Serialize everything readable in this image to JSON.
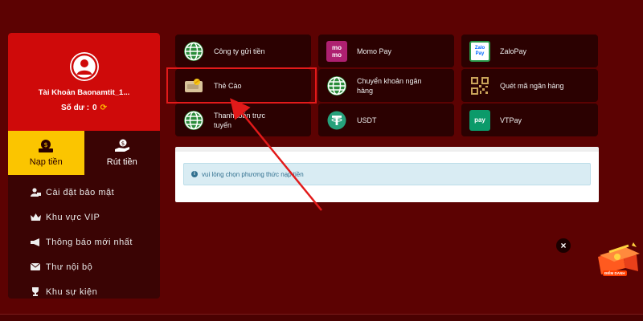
{
  "account": {
    "name": "Tài Khoản Baonamtit_1...",
    "balance_label": "Số dư :",
    "balance_value": "0"
  },
  "tabs": [
    {
      "label": "Nạp tiền",
      "active": true
    },
    {
      "label": "Rút tiền",
      "active": false
    }
  ],
  "menu": [
    {
      "label": "Cài đặt bảo mật",
      "icon": "user-lock-icon"
    },
    {
      "label": "Khu vực VIP",
      "icon": "crown-icon"
    },
    {
      "label": "Thông báo mới nhất",
      "icon": "megaphone-icon"
    },
    {
      "label": "Thư nội bộ",
      "icon": "envelope-icon"
    },
    {
      "label": "Khu sự kiện",
      "icon": "trophy-icon"
    }
  ],
  "payments": [
    {
      "label": "Công ty gửi tiền",
      "icon": "globe-icon"
    },
    {
      "label": "Momo Pay",
      "icon": "momo-icon",
      "icon_text": "mo mo"
    },
    {
      "label": "ZaloPay",
      "icon": "zalopay-icon",
      "icon_text": "Zalo Pay"
    },
    {
      "label": "Thẻ Cào",
      "icon": "card-icon"
    },
    {
      "label": "Chuyển khoản ngân hàng",
      "icon": "globe-icon"
    },
    {
      "label": "Quét mã ngân hàng",
      "icon": "qr-icon"
    },
    {
      "label": "Thanh toán trực tuyến",
      "icon": "globe-icon"
    },
    {
      "label": "USDT",
      "icon": "tether-icon"
    },
    {
      "label": "VTPay",
      "icon": "vtpay-icon",
      "icon_text": "pay"
    }
  ],
  "notice": "vui lòng chọn phương thức nạp tiền",
  "gift_label": "ĐIỂM DANH",
  "colors": {
    "background": "#5c0202",
    "account_card": "#cf0a0a",
    "active_tab": "#fbc500",
    "tile": "#2b0101",
    "highlight": "#e21a1a"
  }
}
